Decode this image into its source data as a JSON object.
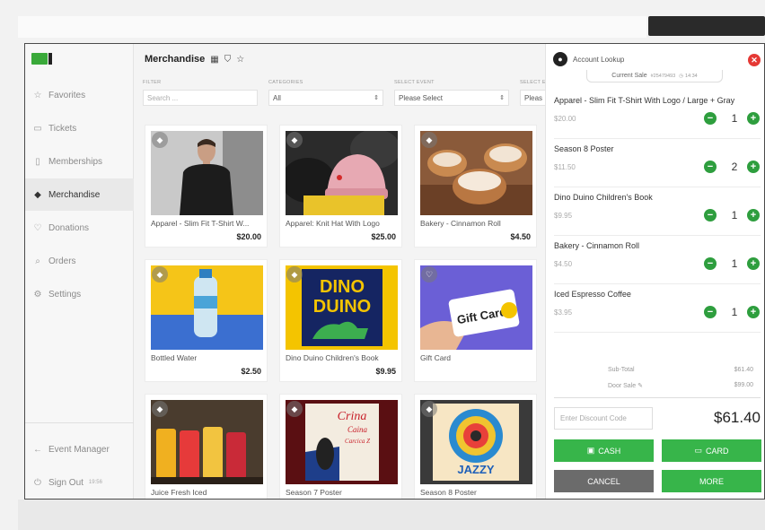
{
  "sidebar": {
    "items": [
      {
        "label": "Favorites",
        "icon": "star-icon"
      },
      {
        "label": "Tickets",
        "icon": "ticket-icon"
      },
      {
        "label": "Memberships",
        "icon": "membership-card-icon"
      },
      {
        "label": "Merchandise",
        "icon": "tag-icon"
      },
      {
        "label": "Donations",
        "icon": "heart-icon"
      },
      {
        "label": "Orders",
        "icon": "search-icon"
      },
      {
        "label": "Settings",
        "icon": "gear-icon"
      }
    ],
    "active": "Merchandise",
    "event_manager": "Event Manager",
    "sign_out": "Sign Out",
    "sign_out_time": "19:56"
  },
  "main": {
    "title": "Merchandise",
    "filters": {
      "filter_label": "FILTER",
      "filter_placeholder": "Search ...",
      "categories_label": "CATEGORIES",
      "categories_value": "All",
      "event_label": "SELECT EVENT",
      "event_value": "Please Select",
      "event2_label": "SELECT E",
      "event2_value": "Pleas"
    },
    "products": [
      {
        "name": "Apparel - Slim Fit T-Shirt W...",
        "price": "$20.00"
      },
      {
        "name": "Apparel: Knit Hat With Logo",
        "price": "$25.00"
      },
      {
        "name": "Bakery - Cinnamon Roll",
        "price": "$4.50"
      },
      {
        "name": "Bottled Water",
        "price": "$2.50"
      },
      {
        "name": "Dino Duino Children's Book",
        "price": "$9.95"
      },
      {
        "name": "Gift Card",
        "price": ""
      },
      {
        "name": "Juice Fresh Iced",
        "price": ""
      },
      {
        "name": "Season 7 Poster",
        "price": ""
      },
      {
        "name": "Season 8 Poster",
        "price": ""
      }
    ],
    "image_text": {
      "dino_line1": "DINO",
      "dino_line2": "DUINO",
      "gift_card": "Gift Card",
      "crina": "Crina",
      "caina": "Caina",
      "crina_sub": "Carcica Z",
      "jazzy": "JAZZY"
    }
  },
  "cart": {
    "account_lookup": "Account Lookup",
    "current_sale": "Current Sale",
    "sale_id": "#25479493",
    "sale_time": "14:34",
    "lines": [
      {
        "name": "Apparel - Slim Fit T-Shirt With Logo / Large + Gray",
        "price": "$20.00",
        "qty": "1"
      },
      {
        "name": "Season 8 Poster",
        "price": "$11.50",
        "qty": "2"
      },
      {
        "name": "Dino Duino Children's Book",
        "price": "$9.95",
        "qty": "1"
      },
      {
        "name": "Bakery - Cinnamon Roll",
        "price": "$4.50",
        "qty": "1"
      },
      {
        "name": "Iced Espresso Coffee",
        "price": "$3.95",
        "qty": "1"
      }
    ],
    "subtotal_label": "Sub-Total",
    "subtotal": "$61.40",
    "door_sale_label": "Door Sale",
    "door_sale": "$99.00",
    "discount_placeholder": "Enter Discount Code",
    "total": "$61.40",
    "cash": "CASH",
    "card": "CARD",
    "cancel": "CANCEL",
    "more": "MORE"
  },
  "colors": {
    "accent_green": "#37b54a",
    "close_red": "#e53935",
    "cancel_gray": "#6b6b6b"
  }
}
